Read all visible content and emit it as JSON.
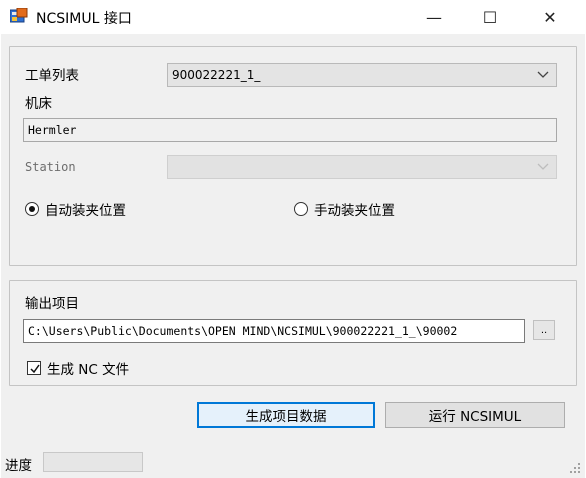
{
  "window": {
    "title": "NCSIMUL 接口",
    "minimize_glyph": "—",
    "maximize_glyph": "☐",
    "close_glyph": "✕"
  },
  "settings": {
    "job_list_label": "工单列表",
    "job_list_value": "900022221_1_",
    "machine_label": "机床",
    "machine_value": "Hermler",
    "station_label": "Station",
    "station_value": "",
    "radio_auto_label": "自动装夹位置",
    "radio_manual_label": "手动装夹位置",
    "selected_clamping": "auto"
  },
  "output": {
    "project_label": "输出项目",
    "project_path": "C:\\Users\\Public\\Documents\\OPEN MIND\\NCSIMUL\\900022221_1_\\90002",
    "browse_label": "..",
    "generate_nc_label": "生成 NC 文件",
    "generate_nc_checked": true
  },
  "actions": {
    "generate_project_label": "生成项目数据",
    "run_ncsimul_label": "运行 NCSIMUL"
  },
  "status": {
    "progress_label": "进度",
    "progress_fraction": 0
  },
  "icons": {
    "app": "ncsimul-app-icon",
    "chevron": "chevron-down-icon",
    "check": "check-icon",
    "grip": "resize-grip-icon"
  },
  "colors": {
    "accent": "#0078d7",
    "client_bg": "#f0f0f0"
  }
}
